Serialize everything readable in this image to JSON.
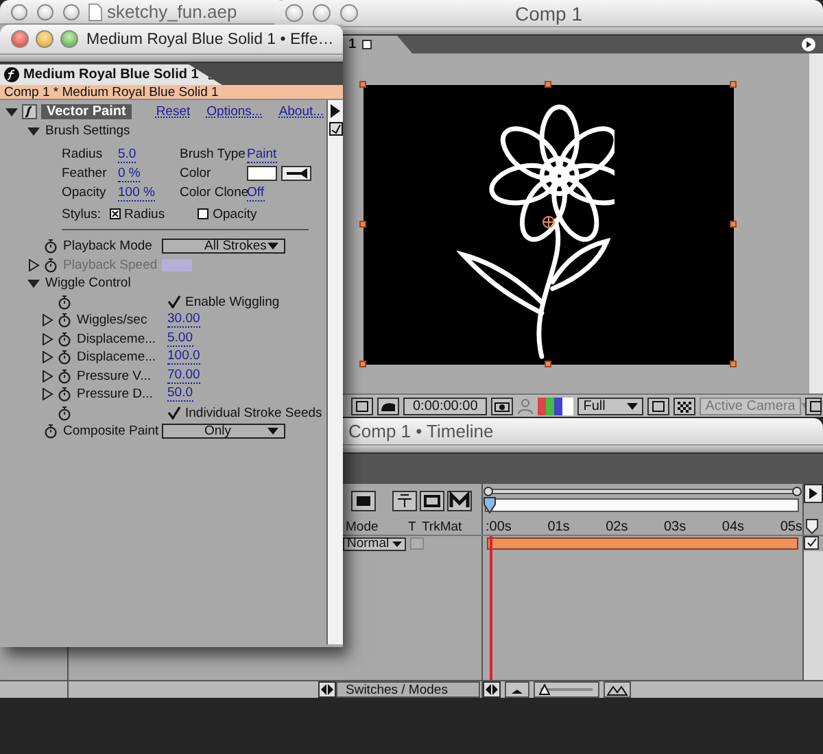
{
  "project_window": {
    "title": "sketchy_fun.aep"
  },
  "comp_window": {
    "title": "Comp 1",
    "tab": "1",
    "toolbar": {
      "timecode": "0:00:00:00",
      "resolution": "Full",
      "camera": {
        "label": "Active Camera",
        "disabled": true
      }
    }
  },
  "timeline_window": {
    "title": "Comp 1 • Timeline",
    "columns": [
      "Mode",
      "T",
      "TrkMat"
    ],
    "ruler": [
      ":00s",
      "01s",
      "02s",
      "03s",
      "04s",
      "05s"
    ],
    "layers": [
      {
        "mode": "Normal"
      }
    ],
    "footer_button": "Switches / Modes",
    "zoom_slider": {
      "level": 0.05
    }
  },
  "effects_window": {
    "title": "Medium Royal Blue Solid 1 • Effe…",
    "tab": "Medium Royal Blue Solid 1",
    "breadcrumb": "Comp 1 * Medium Royal Blue Solid 1",
    "effects": [
      {
        "name": "Vector Paint",
        "expanded": true,
        "links": [
          "Reset",
          "Options...",
          "About..."
        ],
        "properties": [
          {
            "kind": "group",
            "label": "Brush Settings",
            "expanded": true,
            "fields": [
              {
                "kind": "value",
                "label": "Radius",
                "value": "5.0"
              },
              {
                "kind": "value",
                "label": "Brush Type",
                "value": "Paint"
              },
              {
                "kind": "value",
                "label": "Feather",
                "value": "0 %"
              },
              {
                "kind": "swatch",
                "label": "Color"
              },
              {
                "kind": "value",
                "label": "Opacity",
                "value": "100 %"
              },
              {
                "kind": "value",
                "label": "Color Clone",
                "value": "Off"
              }
            ],
            "stylus": {
              "label": "Stylus:",
              "options": [
                {
                  "label": "Radius",
                  "checked": true
                },
                {
                  "label": "Opacity",
                  "checked": false
                }
              ]
            }
          },
          {
            "kind": "dropdown",
            "label": "Playback Mode",
            "value": "All Strokes"
          },
          {
            "kind": "value",
            "label": "Playback Speed",
            "expanded": false,
            "disabled": true
          },
          {
            "kind": "group",
            "label": "Wiggle Control",
            "expanded": true,
            "children": [
              {
                "kind": "checkbox",
                "label": "Enable Wiggling",
                "checked": true
              },
              {
                "kind": "value",
                "label": "Wiggles/sec",
                "value": "30.00",
                "expanded": false,
                "disabled": false
              },
              {
                "kind": "value",
                "label": "Displaceme...",
                "value": "5.00",
                "expanded": false,
                "disabled": false
              },
              {
                "kind": "value",
                "label": "Displaceme...",
                "value": "100.0",
                "expanded": false,
                "disabled": false
              },
              {
                "kind": "value",
                "label": "Pressure V...",
                "value": "70.00",
                "expanded": false,
                "disabled": false
              },
              {
                "kind": "value",
                "label": "Pressure D...",
                "value": "50.0",
                "expanded": false,
                "disabled": false
              },
              {
                "kind": "checkbox",
                "label": "Individual Stroke Seeds",
                "checked": true
              }
            ]
          },
          {
            "kind": "dropdown",
            "label": "Composite Paint",
            "value": "Only"
          }
        ]
      }
    ]
  }
}
